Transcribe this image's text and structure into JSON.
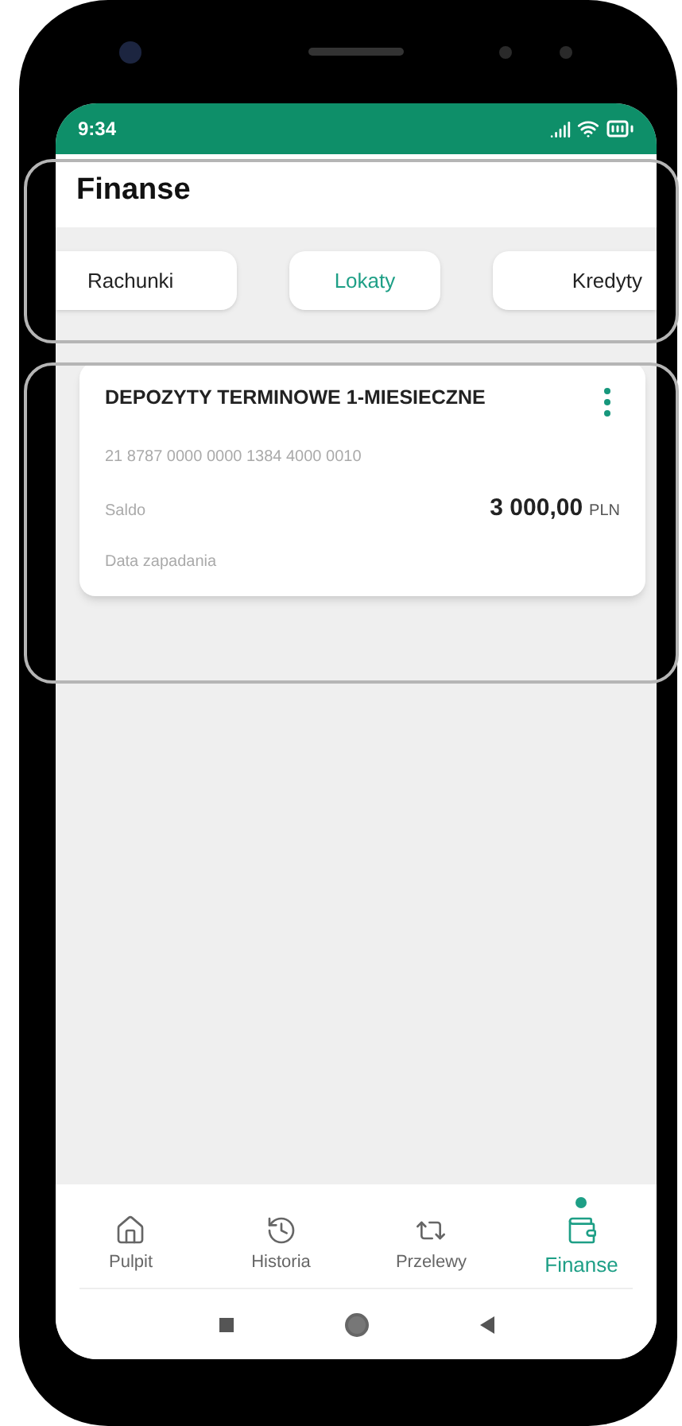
{
  "status_bar": {
    "time": "9:34"
  },
  "header": {
    "title": "Finanse"
  },
  "tabs": [
    {
      "label": "Rachunki",
      "selected": false
    },
    {
      "label": "Lokaty",
      "selected": true
    },
    {
      "label": "Kredyty",
      "selected": false
    }
  ],
  "deposit_card": {
    "title": "DEPOZYTY TERMINOWE 1-MIESIECZNE",
    "account_number": "21 8787 0000 0000 1384 4000 0010",
    "balance_label": "Saldo",
    "balance_amount": "3 000,00",
    "currency": "PLN",
    "maturity_label": "Data zapadania"
  },
  "bottom_nav": [
    {
      "label": "Pulpit",
      "kind": "home",
      "selected": false
    },
    {
      "label": "Historia",
      "kind": "history",
      "selected": false
    },
    {
      "label": "Przelewy",
      "kind": "transfers",
      "selected": false
    },
    {
      "label": "Finanse",
      "kind": "finance",
      "selected": true
    }
  ]
}
